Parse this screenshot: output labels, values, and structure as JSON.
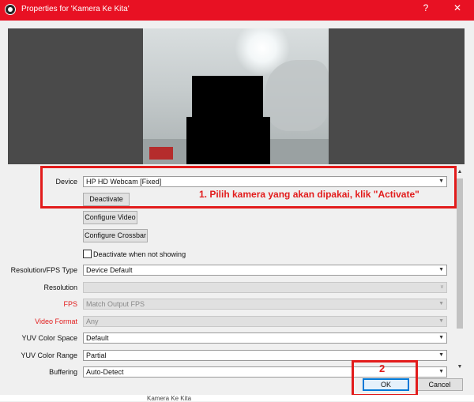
{
  "window": {
    "title": "Properties for 'Kamera Ke Kita'",
    "help_label": "?",
    "close_label": "✕"
  },
  "device": {
    "label": "Device",
    "value": "HP HD Webcam [Fixed]"
  },
  "buttons": {
    "deactivate": "Deactivate",
    "configure_video": "Configure Video",
    "configure_crossbar": "Configure Crossbar",
    "ok": "OK",
    "cancel": "Cancel"
  },
  "checkbox": {
    "label": "Deactivate when not showing",
    "checked": false
  },
  "settings": {
    "resolution_fps_type": {
      "label": "Resolution/FPS Type",
      "value": "Device Default"
    },
    "resolution": {
      "label": "Resolution",
      "value": ""
    },
    "fps": {
      "label": "FPS",
      "value": "Match Output FPS"
    },
    "video_format": {
      "label": "Video Format",
      "value": "Any"
    },
    "yuv_color_space": {
      "label": "YUV Color Space",
      "value": "Default"
    },
    "yuv_color_range": {
      "label": "YUV Color Range",
      "value": "Partial"
    },
    "buffering": {
      "label": "Buffering",
      "value": "Auto-Detect"
    }
  },
  "annotations": {
    "step1": "1.  Pilih kamera yang akan dipakai, klik \"Activate\"",
    "step2": "2"
  },
  "footer": {
    "text": "Kamera Ke Kita"
  },
  "colors": {
    "titlebar": "#e81123",
    "annotation": "#e21c1c",
    "disabled_label": "#e21c1c"
  }
}
